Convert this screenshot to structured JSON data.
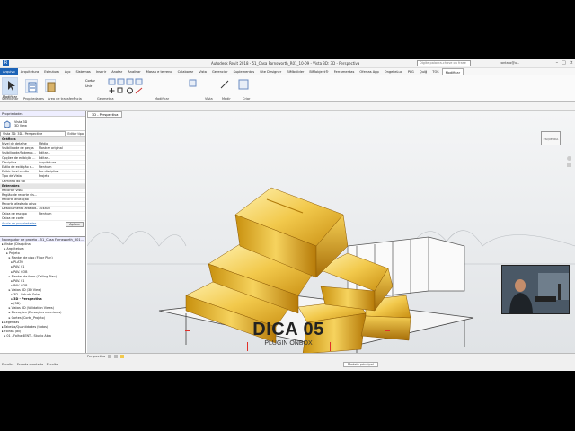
{
  "titlebar": {
    "title": "Autodesk Revit 2018 - 51_Casa Farnsworth_R01_10-09 - Vista 3D: 3D - Perspectiva",
    "search_placeholder": "Digite palavra-chave ou frase",
    "user": "contato@u..."
  },
  "menu": {
    "tabs": [
      "Arquivo",
      "Arquitetura",
      "Estrutura",
      "Aço",
      "Sistemas",
      "Inserir",
      "Anotar",
      "Analisar",
      "Massa e terreno",
      "Colaborar",
      "Vista",
      "Gerenciar",
      "Suplementos",
      "Site Designer",
      "BIMbuilder",
      "BIMobject®",
      "Ferramentas",
      "Ofertas App",
      "OngekeLux",
      "PLG",
      "Quiğ",
      "TOS",
      "Modificar"
    ]
  },
  "ribbon": {
    "groups": [
      "Selecionar",
      "Propriedades",
      "Área de transferência",
      "Geometria",
      "Modificar",
      "Vista",
      "Medir",
      "Criar"
    ],
    "modify_label": "Modificar",
    "cut_label": "Cortar",
    "join_label": "Unir"
  },
  "properties": {
    "title": "Propriedades",
    "type_name": "Vista 3D",
    "type_sub": "3D View",
    "view_selector": "Vista 3D: 3D - Perspective",
    "edit_type": "Editar tipo",
    "graphics_section": "Gráficos",
    "rows": [
      {
        "k": "Nível de detalhe",
        "v": "Médio"
      },
      {
        "k": "Visibilidade de peças",
        "v": "Mostrar original"
      },
      {
        "k": "Visibilidade/Sobrepo...",
        "v": "Editar..."
      },
      {
        "k": "Opções de exibição ...",
        "v": "Editar..."
      },
      {
        "k": "Disciplina",
        "v": "Arquitetura"
      },
      {
        "k": "Estilo de exibição d...",
        "v": "Nenhum"
      },
      {
        "k": "Exibir local oculto",
        "v": "Por disciplina"
      },
      {
        "k": "Tipo de Vista",
        "v": "Projeto"
      },
      {
        "k": "Caminho do sol",
        "v": ""
      }
    ],
    "extents_section": "Extensões",
    "extent_rows": [
      {
        "k": "Recortar vista",
        "v": ""
      },
      {
        "k": "Região de recorte vis...",
        "v": ""
      },
      {
        "k": "Recorte anotação",
        "v": ""
      },
      {
        "k": "Recorte afastado ativo",
        "v": ""
      },
      {
        "k": "Deslocamento afastad...",
        "v": "304800"
      },
      {
        "k": "Caixa de escopo",
        "v": "Nenhum"
      },
      {
        "k": "Caixa de corte",
        "v": ""
      }
    ],
    "help_link": "Ajuda de propriedades",
    "apply": "Aplicar"
  },
  "project_browser": {
    "title": "Navegador de projeto - 51_Casa Farnsworth_R01...",
    "items": [
      "Vistas (Disciplina)",
      "Arquitetura",
      "Projeto",
      "Plantas de piso (Floor Plan)",
      "PLATÔ",
      "PAV. 01",
      "PAV. COB",
      "Plantas de forro (Ceiling Plan)",
      "PAV. 01",
      "PAV. COB",
      "Vistas 3D (3D View)",
      "3D - Estudo Solar",
      "3D - Perspectiva",
      "(3D)",
      "Vistas 3D (Validation Views)",
      "Elevações (Elevações exteriores)",
      "Cortes (Corte_Projeto)",
      "Legendas",
      "Tabelas/Quantidades (todas)",
      "Folhas (all)",
      "01 - Folha 4ENT - Studio Abia"
    ]
  },
  "viewport": {
    "tab": "3D - Perspectiva",
    "view_scale": "Perspectiva",
    "cube_label": "ESQUERDA"
  },
  "status": {
    "left": "Escolha - Escada montada - Escolhe",
    "model": "Modelo principal"
  },
  "overlay": {
    "title": "DICA 05",
    "subtitle": "PLUGIN ONBOX"
  },
  "colors": {
    "accent": "#1c63b7",
    "gold": "#d7a72a",
    "red": "#e0302a"
  }
}
